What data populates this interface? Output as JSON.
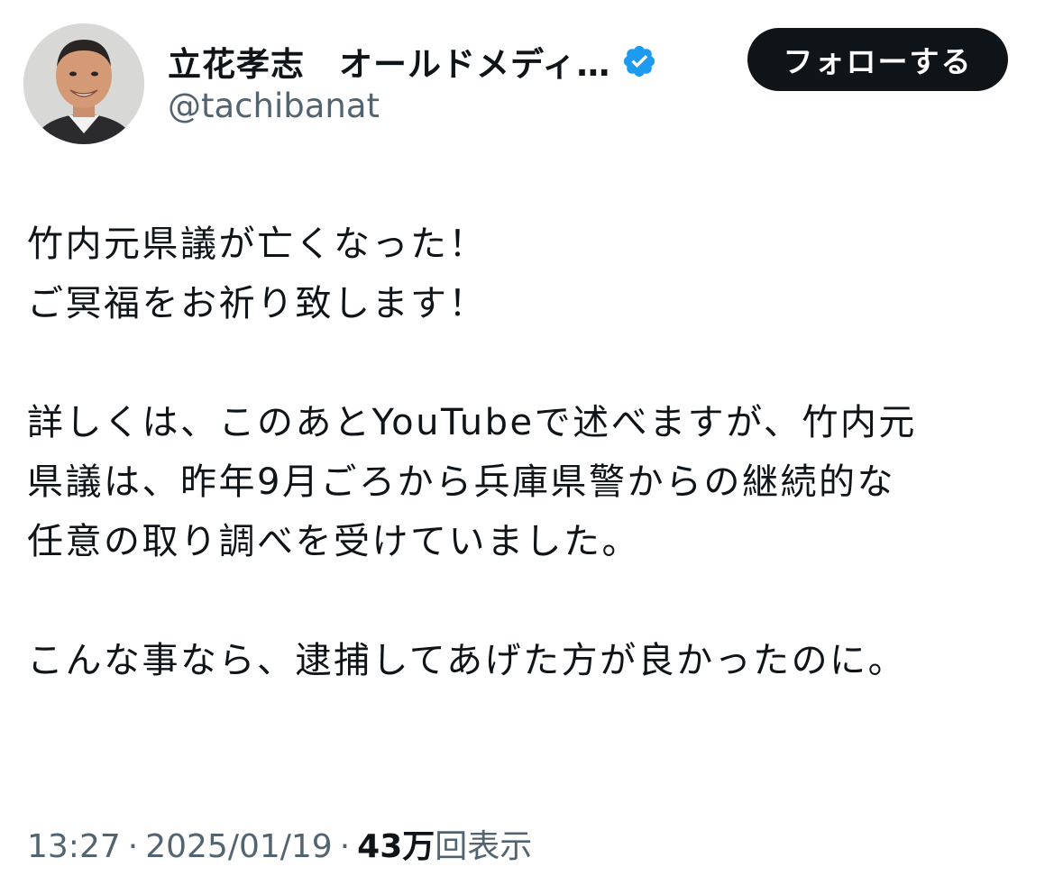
{
  "author": {
    "display_name": "立花孝志　オールドメディ…",
    "handle": "@tachibanat",
    "verified_icon": "verified-badge-icon",
    "verified_color": "#1d9bf0"
  },
  "follow_button": {
    "label": "フォローする",
    "background": "#0f1419"
  },
  "tweet": {
    "paragraph1": {
      "line1": "竹内元県議が亡くなった！",
      "line2": "ご冥福をお祈り致します！"
    },
    "paragraph2": {
      "line1": "詳しくは、このあとYouTubeで述べますが、竹内元",
      "line2": "県議は、昨年9月ごろから兵庫県警からの継続的な",
      "line3": "任意の取り調べを受けていました。"
    },
    "paragraph3": {
      "line1": "こんな事なら、逮捕してあげた方が良かったのに。"
    }
  },
  "meta": {
    "time": "13:27",
    "separator": "·",
    "date": "2025/01/19",
    "views_count": "43万",
    "views_label": "回表示"
  }
}
